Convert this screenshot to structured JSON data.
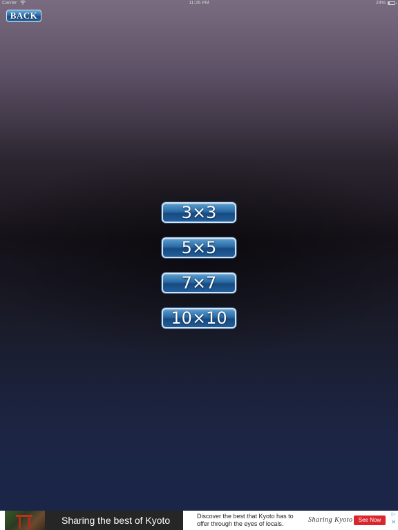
{
  "status_bar": {
    "carrier": "Carrier",
    "wifi_icon": "wifi-icon",
    "time": "11:26 PM",
    "battery": "24%",
    "battery_level": 0.24
  },
  "back_button": {
    "label": "BACK"
  },
  "size_options": [
    {
      "label": "3×3"
    },
    {
      "label": "5×5"
    },
    {
      "label": "7×7"
    },
    {
      "label": "10×10"
    }
  ],
  "ad": {
    "headline": "Sharing the best of Kyoto",
    "description": "Discover the best that Kyoto has to offer through the eyes of locals.",
    "brand": "Sharing Kyoto",
    "cta": "See Now",
    "adchoices_icon": "adchoices-icon",
    "close_icon": "close-icon"
  },
  "colors": {
    "button_blue": "#2a6aa4",
    "button_border": "#d6e4f2",
    "ad_cta_red": "#d8262c"
  }
}
